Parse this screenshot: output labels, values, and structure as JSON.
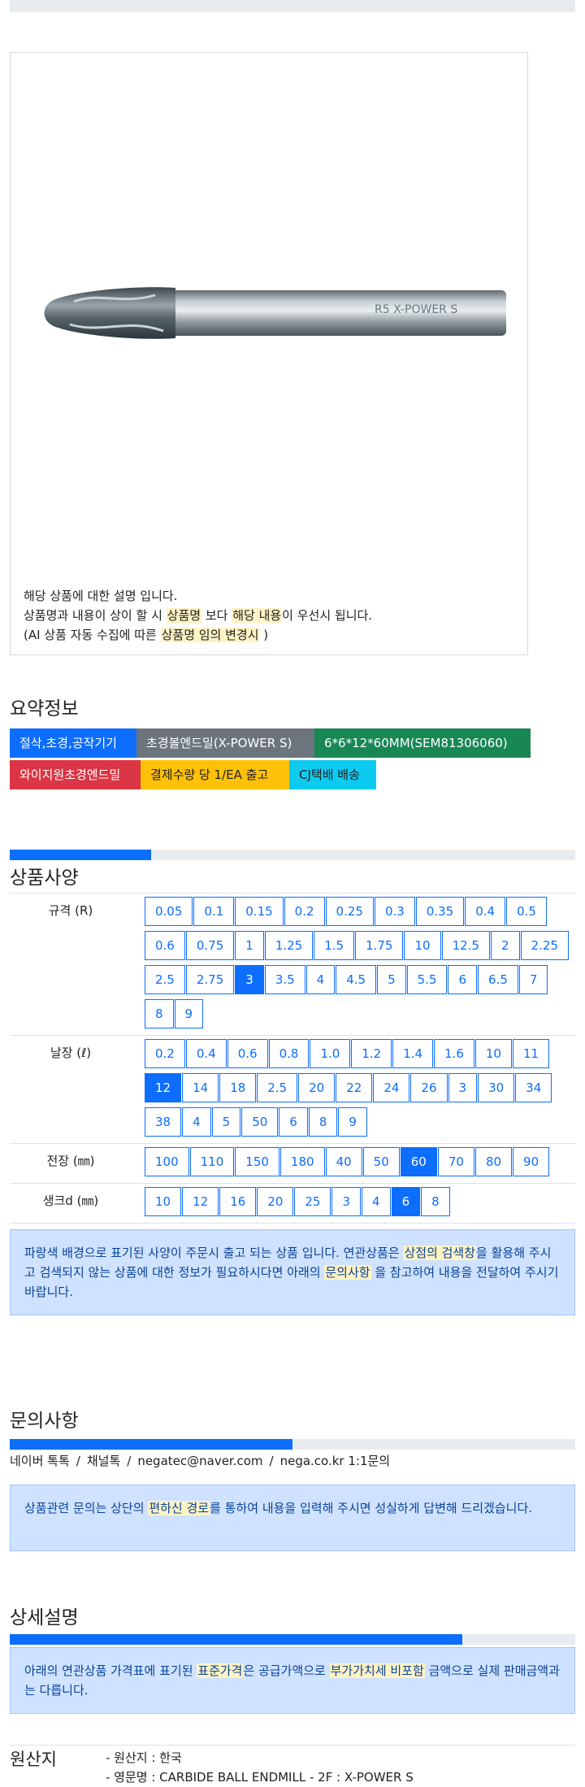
{
  "product": {
    "image_icon": "ball-endmill-image",
    "engraving": "R5  X-POWER S",
    "desc_line1": "해당 상품에 대한 설명 입니다.",
    "desc_line2_pre": "상품명과 내용이 상이 할 시 ",
    "desc_line2_hl1": "상품명",
    "desc_line2_mid": " 보다 ",
    "desc_line2_hl2": "해당 내용",
    "desc_line2_post": "이 우선시 됩니다.",
    "desc_line3_pre": "(AI 상품 자동 수집에 따른 ",
    "desc_line3_hl": "상품명 임의 변경시",
    "desc_line3_post": " )"
  },
  "summary": {
    "title": "요약정보",
    "tags": [
      {
        "label": "절삭,초경,공작기기",
        "color": "#0d6efd"
      },
      {
        "label": "초경볼엔드밀(X-POWER S)",
        "color": "#6c757d"
      },
      {
        "label": "6*6*12*60MM(SEM81306060)",
        "color": "#198754"
      },
      {
        "label": "와이지원초경엔드밀",
        "color": "#dc3545"
      },
      {
        "label": "결제수량 당 1/EA 출고",
        "color": "#ffc107"
      },
      {
        "label": "CJ택배 배송",
        "color": "#0dcaf0"
      }
    ]
  },
  "spec": {
    "title": "상품사양",
    "progress": 0.25,
    "rows": [
      {
        "label": "규격 (R)",
        "selected": "3",
        "values": [
          "0.05",
          "0.1",
          "0.15",
          "0.2",
          "0.25",
          "0.3",
          "0.35",
          "0.4",
          "0.5",
          "0.6",
          "0.75",
          "1",
          "1.25",
          "1.5",
          "1.75",
          "10",
          "12.5",
          "2",
          "2.25",
          "2.5",
          "2.75",
          "3",
          "3.5",
          "4",
          "4.5",
          "5",
          "5.5",
          "6",
          "6.5",
          "7",
          "8",
          "9"
        ]
      },
      {
        "label": "날장 (ℓ)",
        "selected": "12",
        "values": [
          "0.2",
          "0.4",
          "0.6",
          "0.8",
          "1.0",
          "1.2",
          "1.4",
          "1.6",
          "10",
          "11",
          "12",
          "14",
          "18",
          "2.5",
          "20",
          "22",
          "24",
          "26",
          "3",
          "30",
          "34",
          "38",
          "4",
          "5",
          "50",
          "6",
          "8",
          "9"
        ]
      },
      {
        "label": "전장 (㎜)",
        "selected": "60",
        "values": [
          "100",
          "110",
          "150",
          "180",
          "40",
          "50",
          "60",
          "70",
          "80",
          "90"
        ]
      },
      {
        "label": "생크d (㎜)",
        "selected": "6",
        "values": [
          "10",
          "12",
          "16",
          "20",
          "25",
          "3",
          "4",
          "6",
          "8"
        ]
      }
    ],
    "notice_pre": "파랑색 배경으로 표기된 사양이 주문시 출고 되는 상품 입니다. 연관상품은 ",
    "notice_hl1": "상점의 검색창",
    "notice_mid": "을 활용해 주시고 검색되지 않는 상품에 대한 정보가 필요하시다면 아래의 ",
    "notice_hl2": "문의사항",
    "notice_post": " 을 참고하여 내용을 전달하여 주시기 바랍니다."
  },
  "inquiry": {
    "title": "문의사항",
    "progress": 0.5,
    "links": [
      "네이버 톡톡",
      "채널톡",
      "negatec@naver.com",
      "nega.co.kr 1:1문의"
    ],
    "separator": "/",
    "notice_pre": "상품관련 문의는 상단의 ",
    "notice_hl": "편하신 경로",
    "notice_post": "를 통하여 내용을 입력해 주시면 성실하게 답변해 드리겠습니다."
  },
  "detail": {
    "title": "상세설명",
    "progress": 0.8,
    "notice_pre": "아래의 연관상품 가격표에 표기된 ",
    "notice_hl1": "표준가격",
    "notice_mid": "은 공급가액으로 ",
    "notice_hl2": "부가가치세 비포함",
    "notice_post": " 금액으로 실제 판매금액과는 다릅니다."
  },
  "origin": {
    "title": "원산지",
    "items": [
      "- 원산지 : 한국",
      "- 영문명 : CARBIDE BALL ENDMILL - 2F : X-POWER S"
    ]
  }
}
